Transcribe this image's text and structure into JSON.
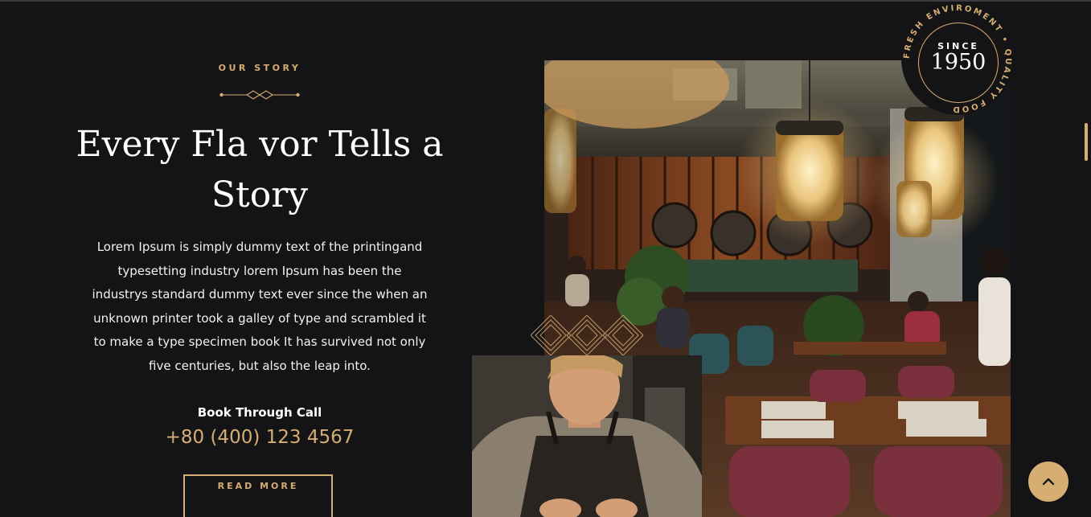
{
  "story": {
    "kicker": "OUR STORY",
    "title_line1": "Every Fla vor Tells a",
    "title_line2": "Story",
    "body": "Lorem Ipsum is simply dummy text of the printingand typesetting industry lorem Ipsum has been the industrys standard dummy text ever since the when an unknown printer took a galley of type and scrambled it to make a type specimen book It has survived not only five centuries, but also the leap into.",
    "call_label": "Book Through Call",
    "phone": "+80 (400) 123 4567",
    "read_more_label": "READ MORE"
  },
  "badge": {
    "ring_text": "FRESH ENVIROMENT • QUALITY FOOD",
    "since_label": "SINCE",
    "year": "1950"
  },
  "colors": {
    "background": "#141417",
    "accent": "#d6ad73",
    "text": "#ffffff"
  },
  "icons": {
    "back_to_top": "chevron-up-icon"
  }
}
